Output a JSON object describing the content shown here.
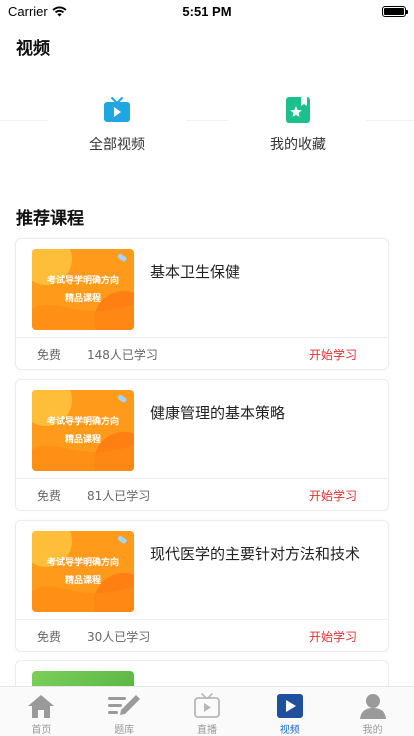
{
  "status_bar": {
    "carrier": "Carrier",
    "time": "5:51 PM",
    "battery_level": 1.0
  },
  "header": {
    "title": "视频"
  },
  "entries": [
    {
      "label": "全部视频",
      "icon": "tv-play-icon",
      "color": "#1fa7e0"
    },
    {
      "label": "我的收藏",
      "icon": "bookmark-star-icon",
      "color": "#1bc08a"
    }
  ],
  "section": {
    "title": "推荐课程"
  },
  "thumbnail_text": {
    "line1": "考试导学明确方向",
    "line2": "精品课程"
  },
  "courses": [
    {
      "title": "基本卫生保健",
      "price": "免费",
      "learners": "148人已学习",
      "action": "开始学习"
    },
    {
      "title": "健康管理的基本策略",
      "price": "免费",
      "learners": "81人已学习",
      "action": "开始学习"
    },
    {
      "title": "现代医学的主要针对方法和技术",
      "price": "免费",
      "learners": "30人已学习",
      "action": "开始学习"
    }
  ],
  "tabs": [
    {
      "label": "首页",
      "icon": "home-icon",
      "active": false
    },
    {
      "label": "题库",
      "icon": "edit-icon",
      "active": false
    },
    {
      "label": "直播",
      "icon": "tv-icon",
      "active": false
    },
    {
      "label": "视频",
      "icon": "video-play-icon",
      "active": true
    },
    {
      "label": "我的",
      "icon": "user-icon",
      "active": false
    }
  ],
  "colors": {
    "accent": "#1f6bd6",
    "action_red": "#e03030",
    "thumb_orange": "#ff9a1a"
  }
}
